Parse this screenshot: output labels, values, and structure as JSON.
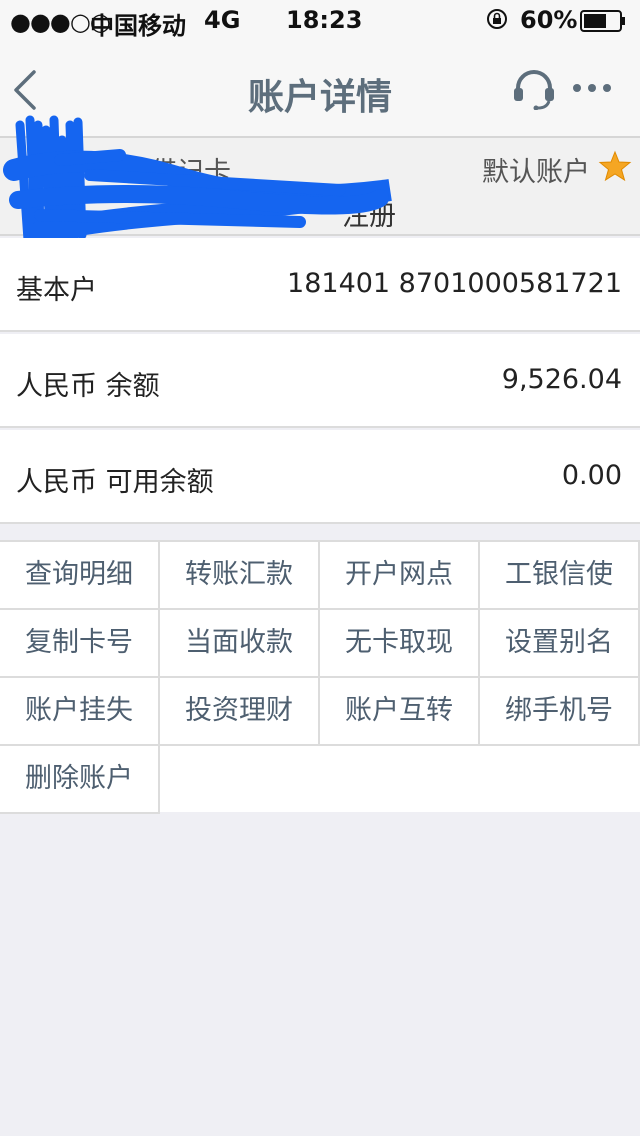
{
  "status_bar": {
    "signal": "●●●○○",
    "carrier": "中国移动",
    "network": "4G",
    "time": "18:23",
    "battery": "60%"
  },
  "nav": {
    "title": "账户详情"
  },
  "account": {
    "card_name": "工银借记卡",
    "default_label": "默认账户",
    "registration": "注册"
  },
  "rows": [
    {
      "label": "基本户",
      "value": "181401 8701000581721"
    },
    {
      "label": "人民币 余额",
      "value": "9,526.04"
    },
    {
      "label": "人民币 可用余额",
      "value": "0.00"
    }
  ],
  "functions": [
    "查询明细",
    "转账汇款",
    "开户网点",
    "工银信使",
    "复制卡号",
    "当面收款",
    "无卡取现",
    "设置别名",
    "账户挂失",
    "投资理财",
    "账户互转",
    "绑手机号",
    "删除账户"
  ],
  "colors": {
    "accent": "#5d6e7c",
    "star": "#f5a623",
    "redaction": "#1565f0"
  }
}
